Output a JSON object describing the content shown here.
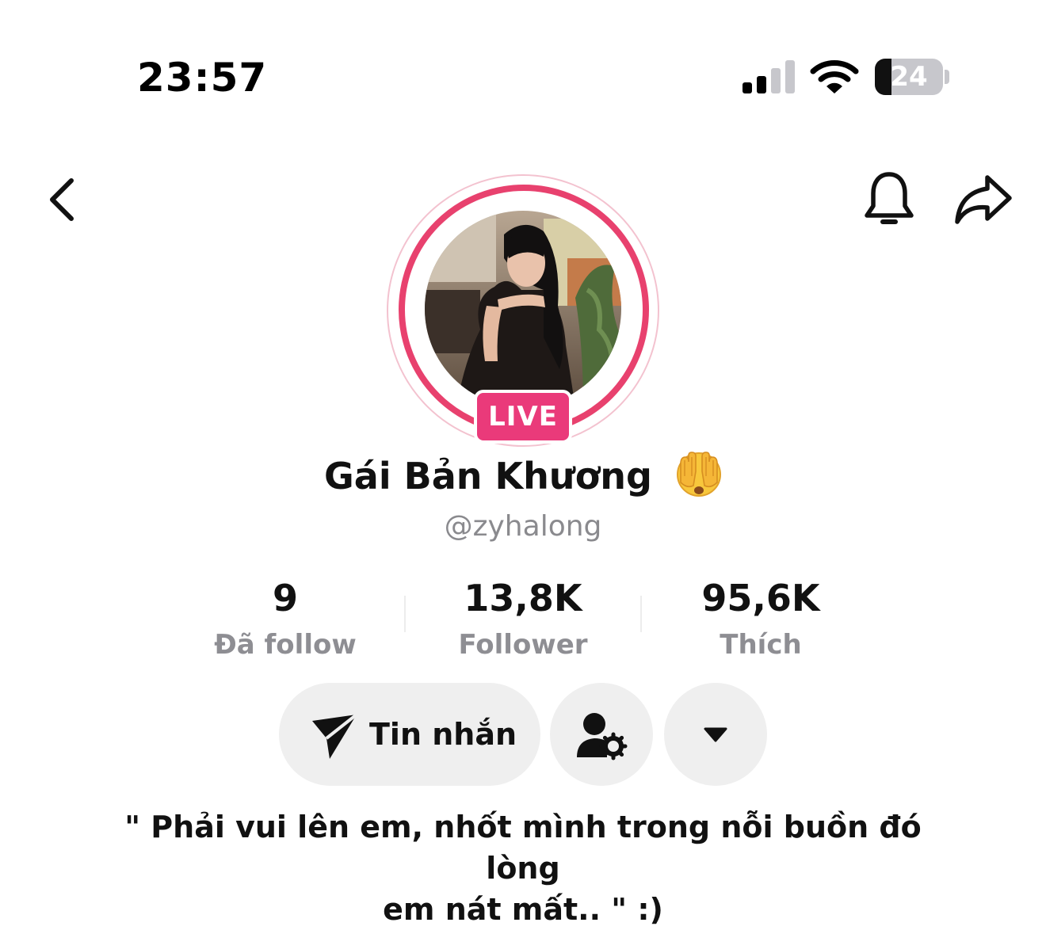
{
  "status_bar": {
    "time": "23:57",
    "battery_level": "24",
    "battery_fraction": 0.24,
    "signal_bars_active": 2,
    "signal_bars_total": 4
  },
  "nav": {
    "back_icon": "chevron-left-icon",
    "notification_icon": "bell-icon",
    "share_icon": "share-arrow-icon"
  },
  "profile": {
    "live_label": "LIVE",
    "display_name": "Gái Bản Khương",
    "name_emoji": "face-with-hands-over-eyes-emoji",
    "handle": "@zyhalong",
    "accent_color": "#e8416e",
    "live_color": "#ea3a7a"
  },
  "stats": [
    {
      "value": "9",
      "label": "Đã follow"
    },
    {
      "value": "13,8K",
      "label": "Follower"
    },
    {
      "value": "95,6K",
      "label": "Thích"
    }
  ],
  "actions": {
    "message_label": "Tin nhắn",
    "message_icon": "send-icon",
    "follow_settings_icon": "user-gear-icon",
    "more_icon": "caret-down-icon"
  },
  "bio": {
    "line1": "\" Phải vui lên em, nhốt mình trong nỗi buồn đó lòng",
    "line2": "em nát mất.. \" :)"
  }
}
